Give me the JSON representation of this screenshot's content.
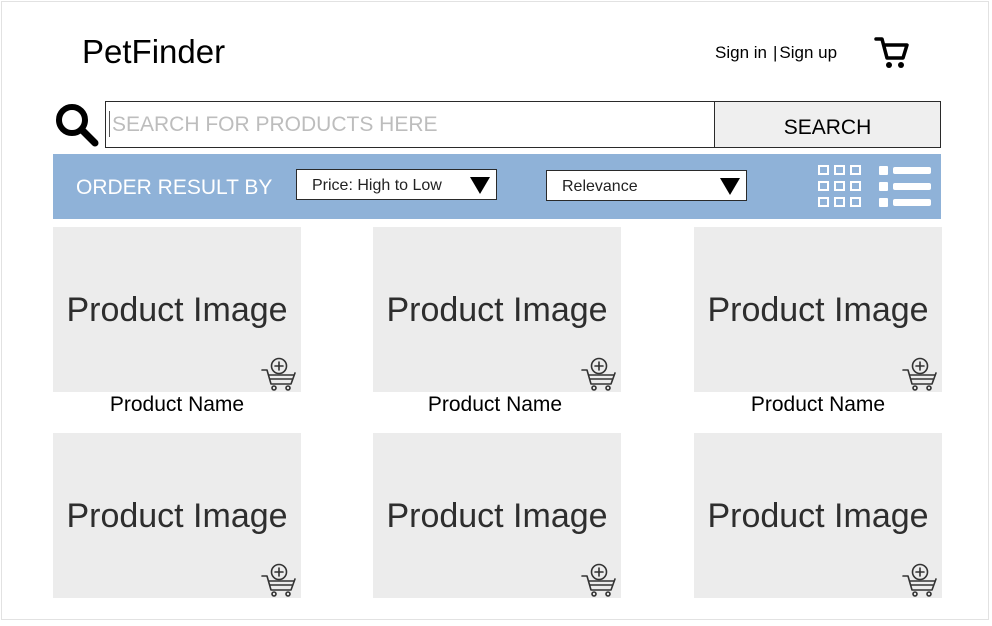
{
  "header": {
    "logo": "PetFinder",
    "sign_in": "Sign in",
    "separator": "|",
    "sign_up": "Sign up",
    "cart_icon": "cart-icon"
  },
  "search": {
    "icon": "search-icon",
    "placeholder": "SEARCH FOR PRODUCTS HERE",
    "value": "",
    "button_label": "SEARCH"
  },
  "toolbar": {
    "order_label": "ORDER RESULT BY",
    "sort_price": "Price: High to Low",
    "sort_relevance": "Relevance",
    "grid_view_icon": "grid-view-icon",
    "list_view_icon": "list-view-icon",
    "background_color": "#8fb2d8"
  },
  "products": [
    {
      "image_label": "Product Image",
      "name": "Product Name"
    },
    {
      "image_label": "Product Image",
      "name": "Product Name"
    },
    {
      "image_label": "Product Image",
      "name": "Product Name"
    },
    {
      "image_label": "Product Image"
    },
    {
      "image_label": "Product Image"
    },
    {
      "image_label": "Product Image"
    }
  ],
  "colors": {
    "card_background": "#ececec",
    "accent": "#8fb2d8"
  }
}
